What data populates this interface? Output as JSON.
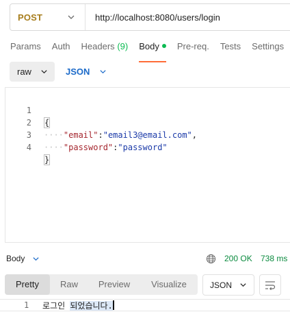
{
  "request": {
    "method": "POST",
    "url": "http://localhost:8080/users/login"
  },
  "tabs": {
    "params": "Params",
    "auth": "Auth",
    "headers": "Headers",
    "headers_count": "(9)",
    "body": "Body",
    "prereq": "Pre-req.",
    "tests": "Tests",
    "settings": "Settings"
  },
  "body_mode": {
    "mode": "raw",
    "language": "JSON"
  },
  "editor": {
    "lines": [
      {
        "number": "1",
        "open": "{"
      },
      {
        "number": "2",
        "indent": "····",
        "key": "\"email\"",
        "sep": ":",
        "value": "\"email3@email.com\"",
        "trail": ","
      },
      {
        "number": "3",
        "indent": "····",
        "key": "\"password\"",
        "sep": ":",
        "value": "\"password\""
      },
      {
        "number": "4",
        "close": "}"
      }
    ]
  },
  "response": {
    "label": "Body",
    "status": "200 OK",
    "time": "738 ms",
    "view_tabs": [
      "Pretty",
      "Raw",
      "Preview",
      "Visualize"
    ],
    "format": "JSON",
    "line_number": "1",
    "text_part1": "로그인 ",
    "text_part2": "되었습니다."
  },
  "colors": {
    "method": "#a77d1c",
    "accent": "#ff6c37",
    "success": "#0cbb52",
    "link": "#1b6ac9"
  }
}
